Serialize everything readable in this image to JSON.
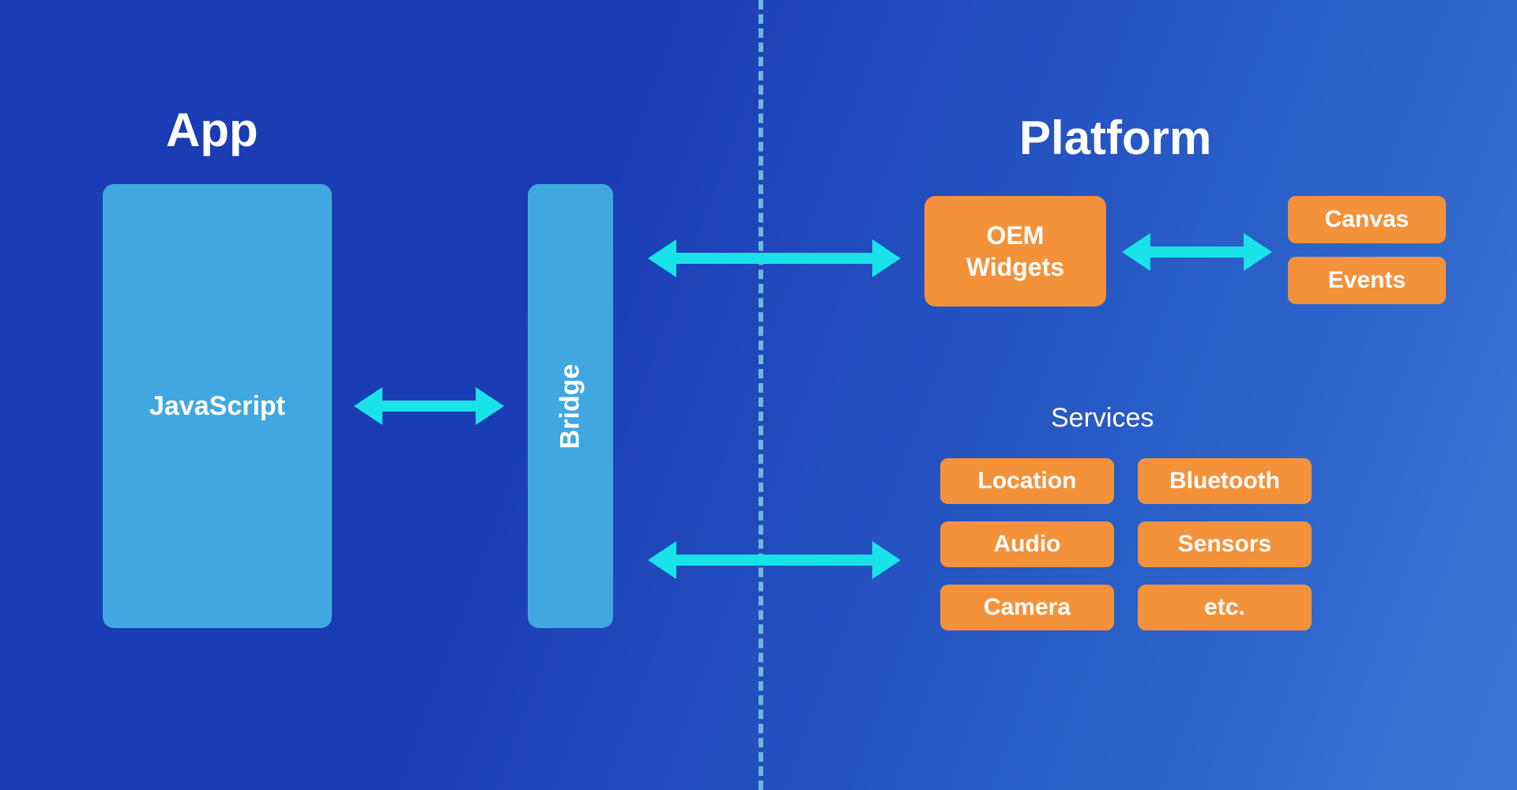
{
  "titles": {
    "left": "App",
    "right": "Platform"
  },
  "left_side": {
    "javascript": "JavaScript",
    "bridge": "Bridge"
  },
  "right_side": {
    "oem_widgets": "OEM\nWidgets",
    "canvas": "Canvas",
    "events": "Events",
    "services_title": "Services",
    "services": {
      "location": "Location",
      "bluetooth": "Bluetooth",
      "audio": "Audio",
      "sensors": "Sensors",
      "camera": "Camera",
      "etc": "etc."
    }
  },
  "colors": {
    "background_gradient_from": "#1a3cb4",
    "background_gradient_to": "#3a78d8",
    "blue_box": "#41a7e1",
    "orange_box": "#f3923a",
    "arrow": "#19e3e8",
    "divider": "#6fb7d9",
    "text": "#ffffff"
  },
  "connections": [
    {
      "from": "javascript",
      "to": "bridge",
      "bidirectional": true
    },
    {
      "from": "bridge",
      "to": "oem_widgets",
      "bidirectional": true
    },
    {
      "from": "bridge",
      "to": "services",
      "bidirectional": true
    },
    {
      "from": "oem_widgets",
      "to": "canvas_events",
      "bidirectional": true
    }
  ]
}
